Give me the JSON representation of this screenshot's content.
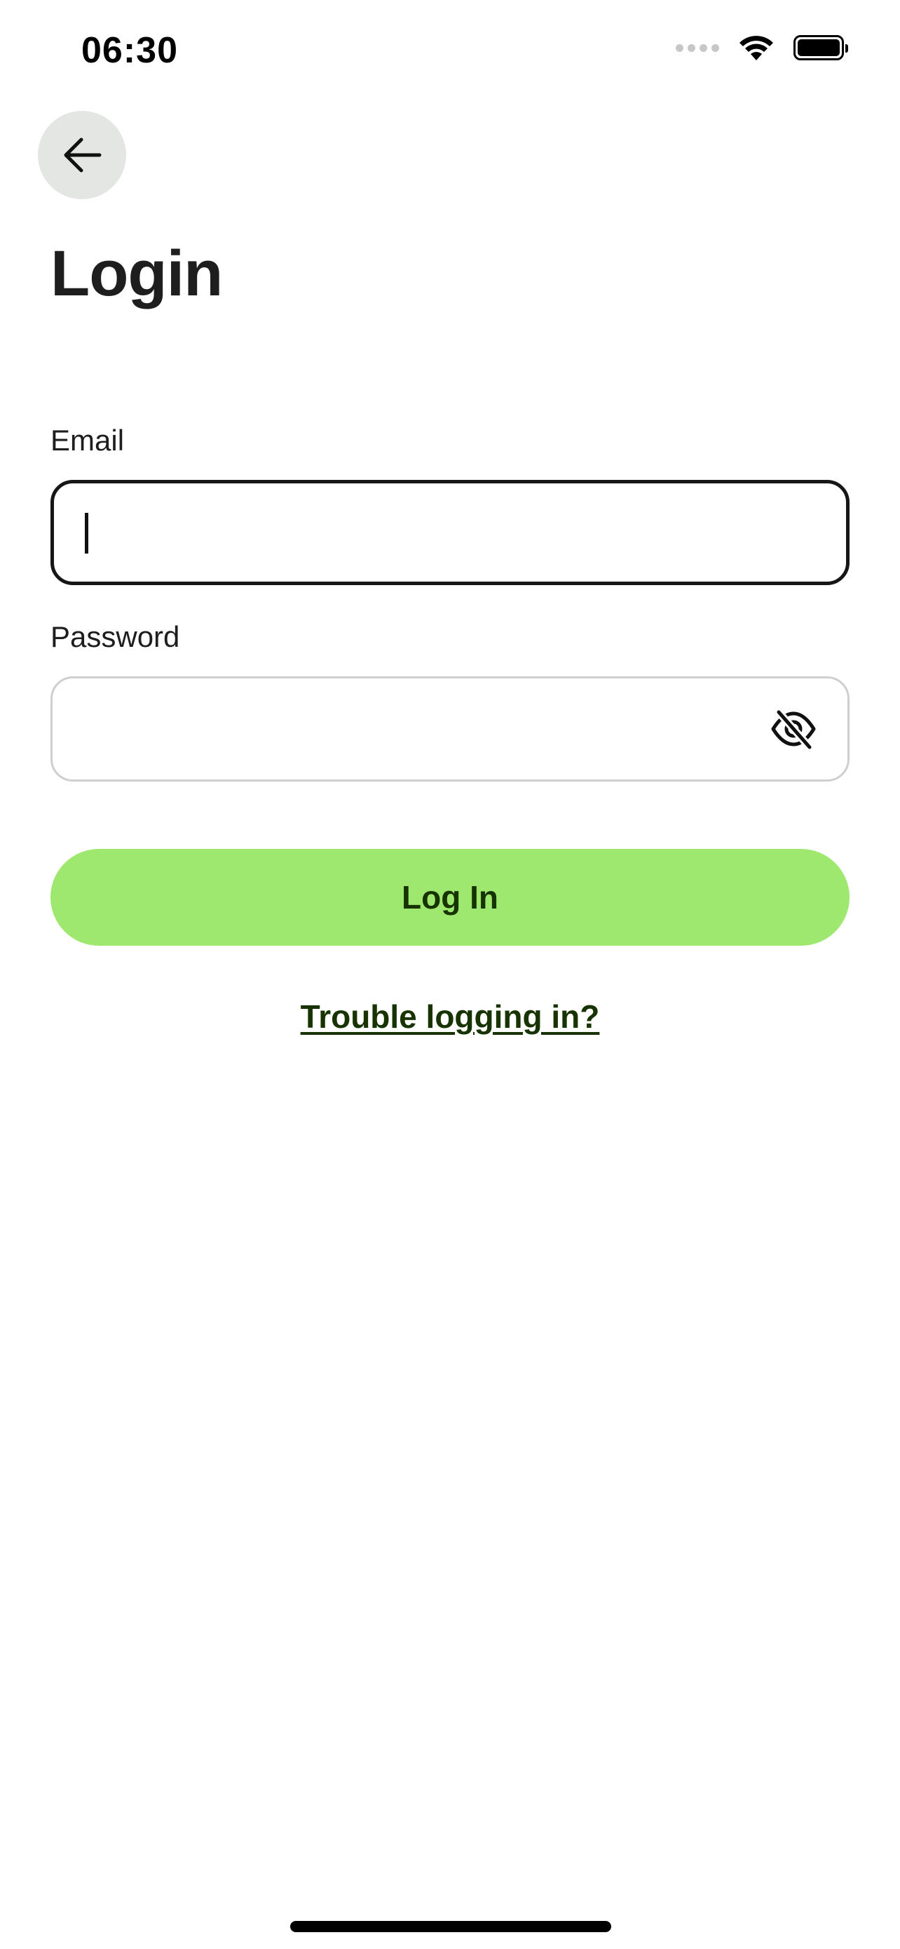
{
  "status_bar": {
    "time": "06:30",
    "icons": [
      "cellular-signal-icon",
      "wifi-icon",
      "battery-icon"
    ]
  },
  "header": {
    "back_icon": "arrow-left-icon",
    "title": "Login"
  },
  "form": {
    "email": {
      "label": "Email",
      "value": "",
      "placeholder": ""
    },
    "password": {
      "label": "Password",
      "value": "",
      "placeholder": "",
      "toggle_icon": "eye-off-icon"
    },
    "submit_label": "Log In",
    "help_link": "Trouble logging in?"
  },
  "colors": {
    "accent": "#9fe870",
    "accent_text": "#163300",
    "back_button_bg": "#e3e6e2",
    "text": "#1e1e1e"
  }
}
